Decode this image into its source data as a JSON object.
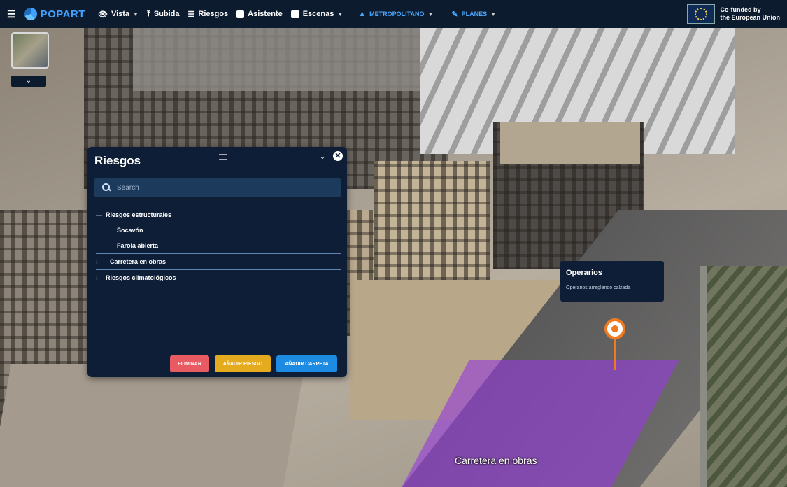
{
  "topbar": {
    "brand": "POPART",
    "items": [
      {
        "label": "Vista",
        "icon": "eye-icon",
        "has_caret": true
      },
      {
        "label": "Subida",
        "icon": "upload-icon",
        "has_caret": false
      },
      {
        "label": "Riesgos",
        "icon": "hierarchy-icon",
        "has_caret": false
      },
      {
        "label": "Asistente",
        "icon": "assistant-icon",
        "has_caret": false
      },
      {
        "label": "Escenas",
        "icon": "scenes-icon",
        "has_caret": true
      },
      {
        "label": "METROPOLITANO",
        "icon": "chart-icon",
        "has_caret": true
      },
      {
        "label": "PLANES",
        "icon": "pen-icon",
        "has_caret": true
      }
    ],
    "eu_text_line1": "Co-funded by",
    "eu_text_line2": "the European Union"
  },
  "panel": {
    "title": "Riesgos",
    "search_placeholder": "Search",
    "tree": [
      {
        "label": "Riesgos estructurales",
        "toggle": "—",
        "level": 0,
        "selected": false
      },
      {
        "label": "Socavón",
        "toggle": "",
        "level": 1,
        "selected": false
      },
      {
        "label": "Farola abierta",
        "toggle": "",
        "level": 1,
        "selected": false
      },
      {
        "label": "Carretera en obras",
        "toggle": "›",
        "level": 0,
        "selected": true
      },
      {
        "label": "Riesgos climatológicos",
        "toggle": "›",
        "level": 0,
        "selected": false
      }
    ],
    "buttons": {
      "delete": "ELIMINAR",
      "add_risk": "AÑADIR RIESGO",
      "add_folder": "AÑADIR CARPETA"
    }
  },
  "tooltip": {
    "title": "Operarios",
    "description": "Operarios arreglando calzada"
  },
  "map_label": "Carretera en obras",
  "colors": {
    "panel_bg": "#0d1e36",
    "accent": "#3fa0ff",
    "btn_delete": "#e85b62",
    "btn_add_risk": "#e5ab1f",
    "btn_add_folder": "#1e8be3",
    "marker": "#ef7a1f",
    "zone": "#9b3fe0"
  }
}
